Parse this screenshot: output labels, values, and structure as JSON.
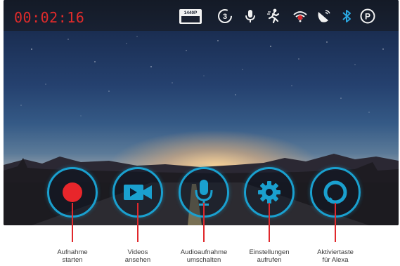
{
  "status_bar": {
    "timer": "00:02:16",
    "resolution_badge": "1440P",
    "icons": [
      "resolution-icon",
      "loop-3-icon",
      "microphone-icon",
      "motion-detection-icon",
      "wifi-off-icon",
      "gps-icon",
      "bluetooth-icon",
      "parking-icon"
    ],
    "icon_color": "#f2f2f2",
    "bluetooth_color": "#2aa7e0",
    "timer_color": "#e02b2b"
  },
  "controls": [
    {
      "icon": "record-icon",
      "caption_line1": "Aufnahme",
      "caption_line2": "starten"
    },
    {
      "icon": "video-camera-icon",
      "caption_line1": "Videos",
      "caption_line2": "ansehen"
    },
    {
      "icon": "microphone-icon",
      "caption_line1": "Audioaufnahme",
      "caption_line2": "umschalten"
    },
    {
      "icon": "settings-gear-icon",
      "caption_line1": "Einstellungen",
      "caption_line2": "aufrufen"
    },
    {
      "icon": "alexa-icon",
      "caption_line1": "Aktiviertaste",
      "caption_line2": "für Alexa"
    }
  ],
  "colors": {
    "button_ring": "#1aa0cf",
    "button_icon": "#1aa0cf",
    "record_dot": "#e8262b",
    "callout_line": "#e0282c"
  }
}
